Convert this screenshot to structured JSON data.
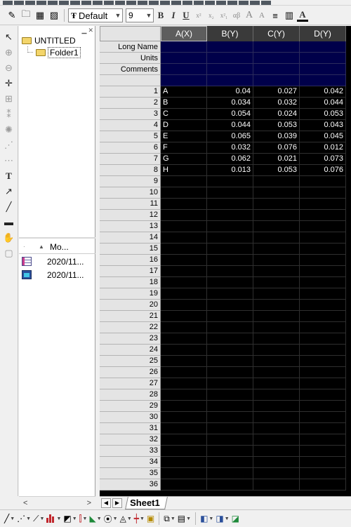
{
  "toolbar": {
    "font_name": "Default",
    "font_size": "9",
    "bold": "B",
    "italic": "I",
    "underline": "U",
    "superscript": "x²",
    "subscript": "x₂",
    "super_sub": "x²₁",
    "greek": "αβ",
    "increase_font": "A",
    "decrease_font": "A",
    "fill_color": "A"
  },
  "explorer": {
    "root": "UNTITLED",
    "folder": "Folder1",
    "list_header": "Mo...",
    "items": [
      {
        "icon": "worksheet-icon",
        "modified": "2020/11..."
      },
      {
        "icon": "graph-icon",
        "modified": "2020/11..."
      }
    ]
  },
  "worksheet": {
    "columns": [
      "A(X)",
      "B(Y)",
      "C(Y)",
      "D(Y)"
    ],
    "meta_labels": [
      "Long Name",
      "Units",
      "Comments",
      ""
    ],
    "rows": [
      [
        "A",
        "0.04",
        "0.027",
        "0.042"
      ],
      [
        "B",
        "0.034",
        "0.032",
        "0.044"
      ],
      [
        "C",
        "0.054",
        "0.024",
        "0.053"
      ],
      [
        "D",
        "0.044",
        "0.053",
        "0.043"
      ],
      [
        "E",
        "0.065",
        "0.039",
        "0.045"
      ],
      [
        "F",
        "0.032",
        "0.076",
        "0.012"
      ],
      [
        "G",
        "0.062",
        "0.021",
        "0.073"
      ],
      [
        "H",
        "0.013",
        "0.053",
        "0.076"
      ]
    ],
    "visible_row_count": 36
  },
  "tabs": {
    "sheet": "Sheet1"
  },
  "colors": {
    "grid_background": "#000000",
    "meta_background": "#00004a",
    "header_background": "#e4e4e4",
    "selected_column_header": "#5d5d5d"
  }
}
